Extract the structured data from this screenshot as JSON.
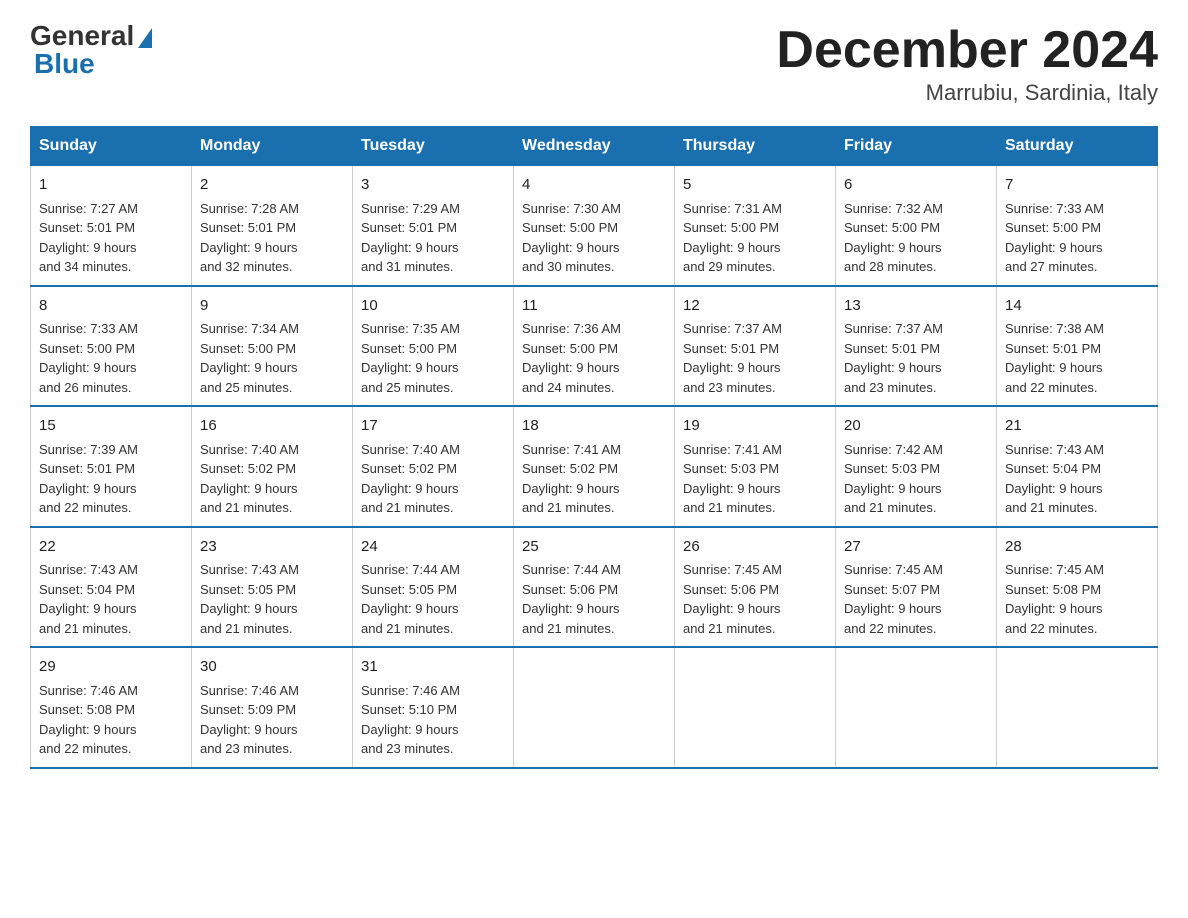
{
  "logo": {
    "general": "General",
    "blue": "Blue"
  },
  "title": {
    "month_year": "December 2024",
    "location": "Marrubiu, Sardinia, Italy"
  },
  "days_of_week": [
    "Sunday",
    "Monday",
    "Tuesday",
    "Wednesday",
    "Thursday",
    "Friday",
    "Saturday"
  ],
  "weeks": [
    [
      {
        "day": "1",
        "sunrise": "7:27 AM",
        "sunset": "5:01 PM",
        "daylight": "9 hours and 34 minutes."
      },
      {
        "day": "2",
        "sunrise": "7:28 AM",
        "sunset": "5:01 PM",
        "daylight": "9 hours and 32 minutes."
      },
      {
        "day": "3",
        "sunrise": "7:29 AM",
        "sunset": "5:01 PM",
        "daylight": "9 hours and 31 minutes."
      },
      {
        "day": "4",
        "sunrise": "7:30 AM",
        "sunset": "5:00 PM",
        "daylight": "9 hours and 30 minutes."
      },
      {
        "day": "5",
        "sunrise": "7:31 AM",
        "sunset": "5:00 PM",
        "daylight": "9 hours and 29 minutes."
      },
      {
        "day": "6",
        "sunrise": "7:32 AM",
        "sunset": "5:00 PM",
        "daylight": "9 hours and 28 minutes."
      },
      {
        "day": "7",
        "sunrise": "7:33 AM",
        "sunset": "5:00 PM",
        "daylight": "9 hours and 27 minutes."
      }
    ],
    [
      {
        "day": "8",
        "sunrise": "7:33 AM",
        "sunset": "5:00 PM",
        "daylight": "9 hours and 26 minutes."
      },
      {
        "day": "9",
        "sunrise": "7:34 AM",
        "sunset": "5:00 PM",
        "daylight": "9 hours and 25 minutes."
      },
      {
        "day": "10",
        "sunrise": "7:35 AM",
        "sunset": "5:00 PM",
        "daylight": "9 hours and 25 minutes."
      },
      {
        "day": "11",
        "sunrise": "7:36 AM",
        "sunset": "5:00 PM",
        "daylight": "9 hours and 24 minutes."
      },
      {
        "day": "12",
        "sunrise": "7:37 AM",
        "sunset": "5:01 PM",
        "daylight": "9 hours and 23 minutes."
      },
      {
        "day": "13",
        "sunrise": "7:37 AM",
        "sunset": "5:01 PM",
        "daylight": "9 hours and 23 minutes."
      },
      {
        "day": "14",
        "sunrise": "7:38 AM",
        "sunset": "5:01 PM",
        "daylight": "9 hours and 22 minutes."
      }
    ],
    [
      {
        "day": "15",
        "sunrise": "7:39 AM",
        "sunset": "5:01 PM",
        "daylight": "9 hours and 22 minutes."
      },
      {
        "day": "16",
        "sunrise": "7:40 AM",
        "sunset": "5:02 PM",
        "daylight": "9 hours and 21 minutes."
      },
      {
        "day": "17",
        "sunrise": "7:40 AM",
        "sunset": "5:02 PM",
        "daylight": "9 hours and 21 minutes."
      },
      {
        "day": "18",
        "sunrise": "7:41 AM",
        "sunset": "5:02 PM",
        "daylight": "9 hours and 21 minutes."
      },
      {
        "day": "19",
        "sunrise": "7:41 AM",
        "sunset": "5:03 PM",
        "daylight": "9 hours and 21 minutes."
      },
      {
        "day": "20",
        "sunrise": "7:42 AM",
        "sunset": "5:03 PM",
        "daylight": "9 hours and 21 minutes."
      },
      {
        "day": "21",
        "sunrise": "7:43 AM",
        "sunset": "5:04 PM",
        "daylight": "9 hours and 21 minutes."
      }
    ],
    [
      {
        "day": "22",
        "sunrise": "7:43 AM",
        "sunset": "5:04 PM",
        "daylight": "9 hours and 21 minutes."
      },
      {
        "day": "23",
        "sunrise": "7:43 AM",
        "sunset": "5:05 PM",
        "daylight": "9 hours and 21 minutes."
      },
      {
        "day": "24",
        "sunrise": "7:44 AM",
        "sunset": "5:05 PM",
        "daylight": "9 hours and 21 minutes."
      },
      {
        "day": "25",
        "sunrise": "7:44 AM",
        "sunset": "5:06 PM",
        "daylight": "9 hours and 21 minutes."
      },
      {
        "day": "26",
        "sunrise": "7:45 AM",
        "sunset": "5:06 PM",
        "daylight": "9 hours and 21 minutes."
      },
      {
        "day": "27",
        "sunrise": "7:45 AM",
        "sunset": "5:07 PM",
        "daylight": "9 hours and 22 minutes."
      },
      {
        "day": "28",
        "sunrise": "7:45 AM",
        "sunset": "5:08 PM",
        "daylight": "9 hours and 22 minutes."
      }
    ],
    [
      {
        "day": "29",
        "sunrise": "7:46 AM",
        "sunset": "5:08 PM",
        "daylight": "9 hours and 22 minutes."
      },
      {
        "day": "30",
        "sunrise": "7:46 AM",
        "sunset": "5:09 PM",
        "daylight": "9 hours and 23 minutes."
      },
      {
        "day": "31",
        "sunrise": "7:46 AM",
        "sunset": "5:10 PM",
        "daylight": "9 hours and 23 minutes."
      },
      null,
      null,
      null,
      null
    ]
  ],
  "labels": {
    "sunrise": "Sunrise:",
    "sunset": "Sunset:",
    "daylight": "Daylight:"
  }
}
